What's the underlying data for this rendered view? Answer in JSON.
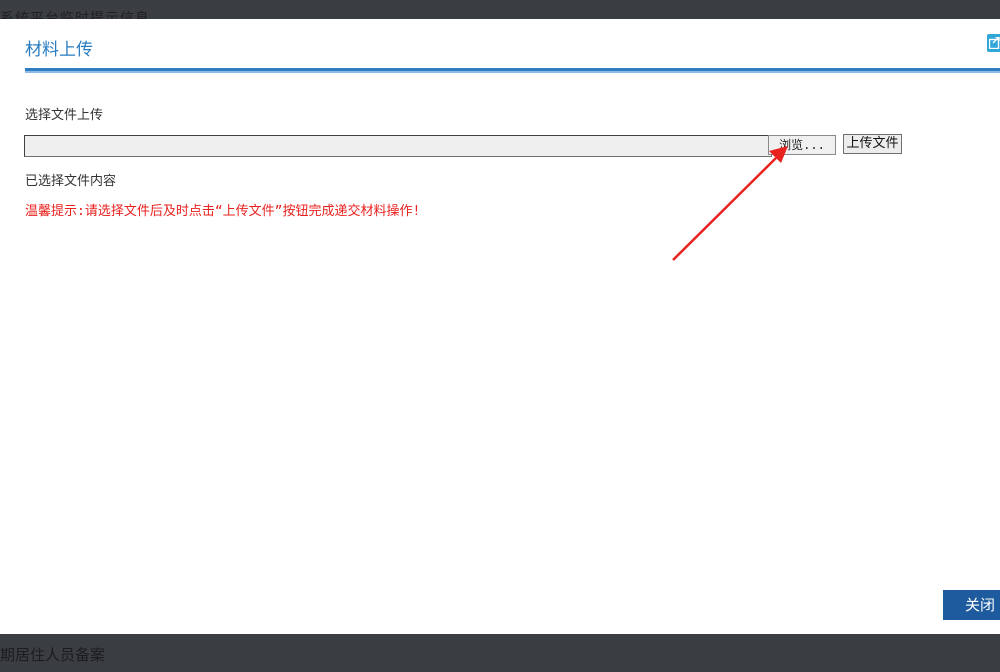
{
  "backdrop": {
    "top_text": "系统平台临时提示信息",
    "bottom_text": "期居住人员备案"
  },
  "dialog": {
    "title": "材料上传",
    "choose_label": "选择文件上传",
    "file_input_value": "",
    "browse_label": "浏览...",
    "upload_label": "上传文件",
    "selected_label": "已选择文件内容",
    "tip": "温馨提示:请选择文件后及时点击“上传文件”按钮完成递交材料操作!",
    "close_label": "关闭"
  },
  "icons": {
    "restore": "window-restore-icon",
    "annotation": "red-arrow-annotation"
  },
  "colors": {
    "title": "#2a7cc0",
    "accent_rule": "#2f7dc3",
    "tip": "#e8221f",
    "close_button": "#1e5b9e",
    "annotation_arrow": "#e8221f"
  }
}
